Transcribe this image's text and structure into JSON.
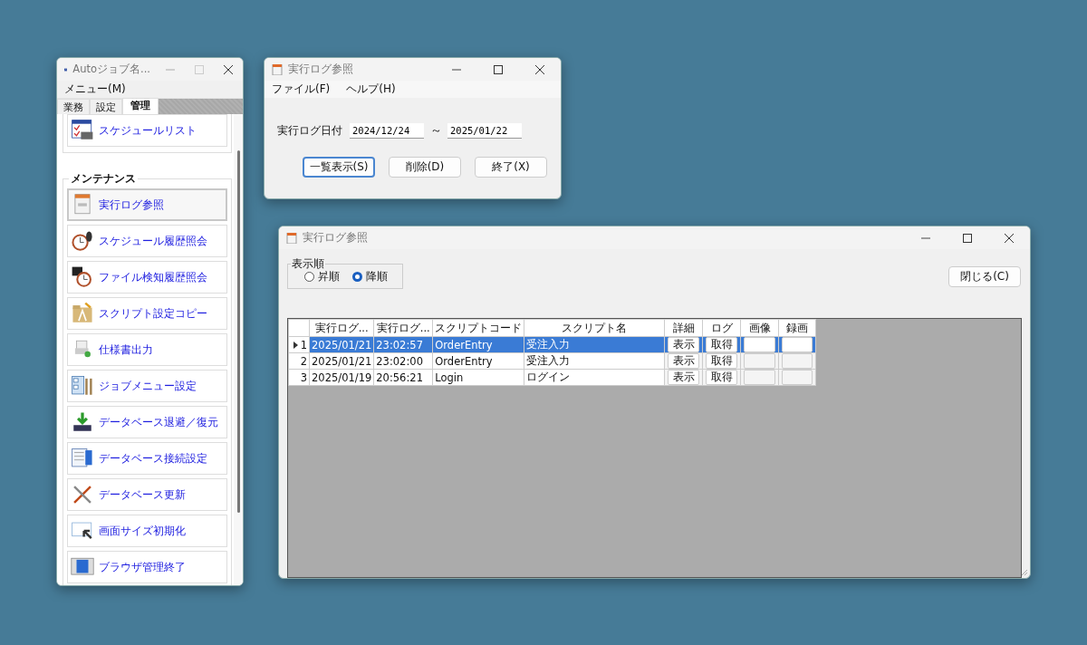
{
  "launcher": {
    "title": "Autoジョブ名...",
    "menu": [
      "メニュー(M)"
    ],
    "tabs": [
      {
        "label": "業務",
        "selected": false
      },
      {
        "label": "設定",
        "selected": false
      },
      {
        "label": "管理",
        "selected": true
      }
    ],
    "top_items": [
      {
        "label": "スケジュールリスト",
        "selected": false
      }
    ],
    "section": "メンテナンス",
    "items": [
      {
        "label": "実行ログ参照",
        "selected": true
      },
      {
        "label": "スケジュール履歴照会",
        "selected": false
      },
      {
        "label": "ファイル検知履歴照会",
        "selected": false
      },
      {
        "label": "スクリプト設定コピー",
        "selected": false
      },
      {
        "label": "仕様書出力",
        "selected": false
      },
      {
        "label": "ジョブメニュー設定",
        "selected": false
      },
      {
        "label": "データベース退避／復元",
        "selected": false
      },
      {
        "label": "データベース接続設定",
        "selected": false
      },
      {
        "label": "データベース更新",
        "selected": false
      },
      {
        "label": "画面サイズ初期化",
        "selected": false
      },
      {
        "label": "ブラウザ管理終了",
        "selected": false
      }
    ]
  },
  "search_window": {
    "title": "実行ログ参照",
    "menu": [
      "ファイル(F)",
      "ヘルプ(H)"
    ],
    "date_label": "実行ログ日付",
    "date_from": "2024/12/24",
    "separator": "～",
    "date_to": "2025/01/22",
    "buttons": [
      {
        "label": "一覧表示(S)",
        "default": true
      },
      {
        "label": "削除(D)",
        "default": false
      },
      {
        "label": "終了(X)",
        "default": false
      }
    ]
  },
  "result_window": {
    "title": "実行ログ参照",
    "order_group": "表示順",
    "order_options": [
      {
        "label": "昇順",
        "selected": false
      },
      {
        "label": "降順",
        "selected": true
      }
    ],
    "close_button": "閉じる(C)",
    "table": {
      "columns": [
        {
          "label": "実行ログ...",
          "kind": "text"
        },
        {
          "label": "実行ログ...",
          "kind": "text"
        },
        {
          "label": "スクリプトコード",
          "kind": "text"
        },
        {
          "label": "スクリプト名",
          "kind": "text"
        },
        {
          "label": "詳細",
          "kind": "button"
        },
        {
          "label": "ログ",
          "kind": "button"
        },
        {
          "label": "画像",
          "kind": "blank"
        },
        {
          "label": "録画",
          "kind": "blank"
        }
      ],
      "rows": [
        {
          "number": "1",
          "selected": true,
          "cells": [
            "2025/01/21",
            "23:02:57",
            "OrderEntry",
            "受注入力",
            "表示",
            "取得"
          ]
        },
        {
          "number": "2",
          "selected": false,
          "cells": [
            "2025/01/21",
            "23:02:00",
            "OrderEntry",
            "受注入力",
            "表示",
            "取得"
          ]
        },
        {
          "number": "3",
          "selected": false,
          "cells": [
            "2025/01/19",
            "20:56:21",
            "Login",
            "ログイン",
            "表示",
            "取得"
          ]
        }
      ]
    }
  }
}
